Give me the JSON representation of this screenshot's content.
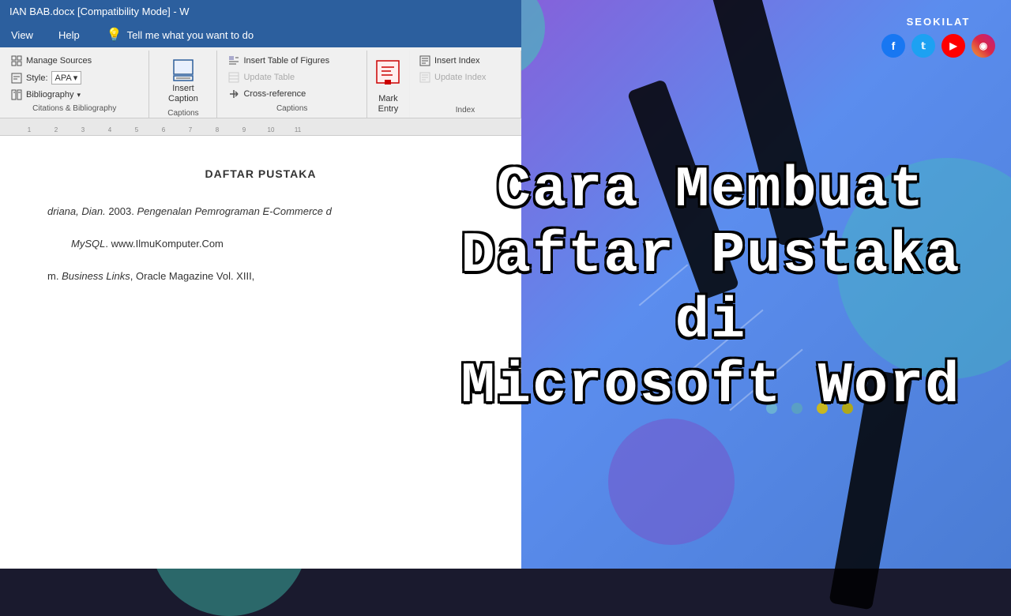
{
  "window": {
    "title": "IAN BAB.docx [Compatibility Mode] - W",
    "brand": "SEOKILAT"
  },
  "menu": {
    "items": [
      "View",
      "Help"
    ],
    "tell_me": "Tell me what you want to do"
  },
  "ribbon": {
    "groups": {
      "citations": {
        "label": "Citations & Bibliography",
        "manage_sources": "Manage Sources",
        "style_label": "Style:",
        "style_value": "APA",
        "bibliography": "Bibliography"
      },
      "caption": {
        "label": "Insert Caption",
        "btn_label": "Insert\nCaption"
      },
      "captions": {
        "label": "Captions",
        "insert_table_of_figures": "Insert Table of Figures",
        "update_table": "Update Table",
        "cross_reference": "Cross-reference"
      },
      "mark_entry": {
        "label": "Mark Entry",
        "insert_index": "Insert Index",
        "update_index": "Update Index"
      }
    }
  },
  "ruler": {
    "marks": [
      "1",
      "2",
      "3",
      "4",
      "5",
      "6",
      "7",
      "8",
      "9",
      "10",
      "11"
    ]
  },
  "document": {
    "heading": "DAFTAR PUSTAKA",
    "entries": [
      {
        "text": "driana, Dian. 2003. Pengenalan Pemrograman E-Commerce d",
        "continuation": "MySQL. www.IlmuKomputer.Com"
      },
      {
        "text": "m. Business Links, Oracle Magazine Vol. XIII,"
      }
    ]
  },
  "overlay": {
    "line1": "Cara Membuat",
    "line2": "Daftar Pustaka di",
    "line3": "Microsoft Word"
  },
  "dots": {
    "colors": [
      "#6ab0d4",
      "#5a9fc4",
      "#c8b820",
      "#b0a818"
    ]
  },
  "social": {
    "items": [
      {
        "name": "facebook",
        "label": "f"
      },
      {
        "name": "twitter",
        "label": "t"
      },
      {
        "name": "youtube",
        "label": "▶"
      },
      {
        "name": "instagram",
        "label": "📷"
      }
    ]
  }
}
